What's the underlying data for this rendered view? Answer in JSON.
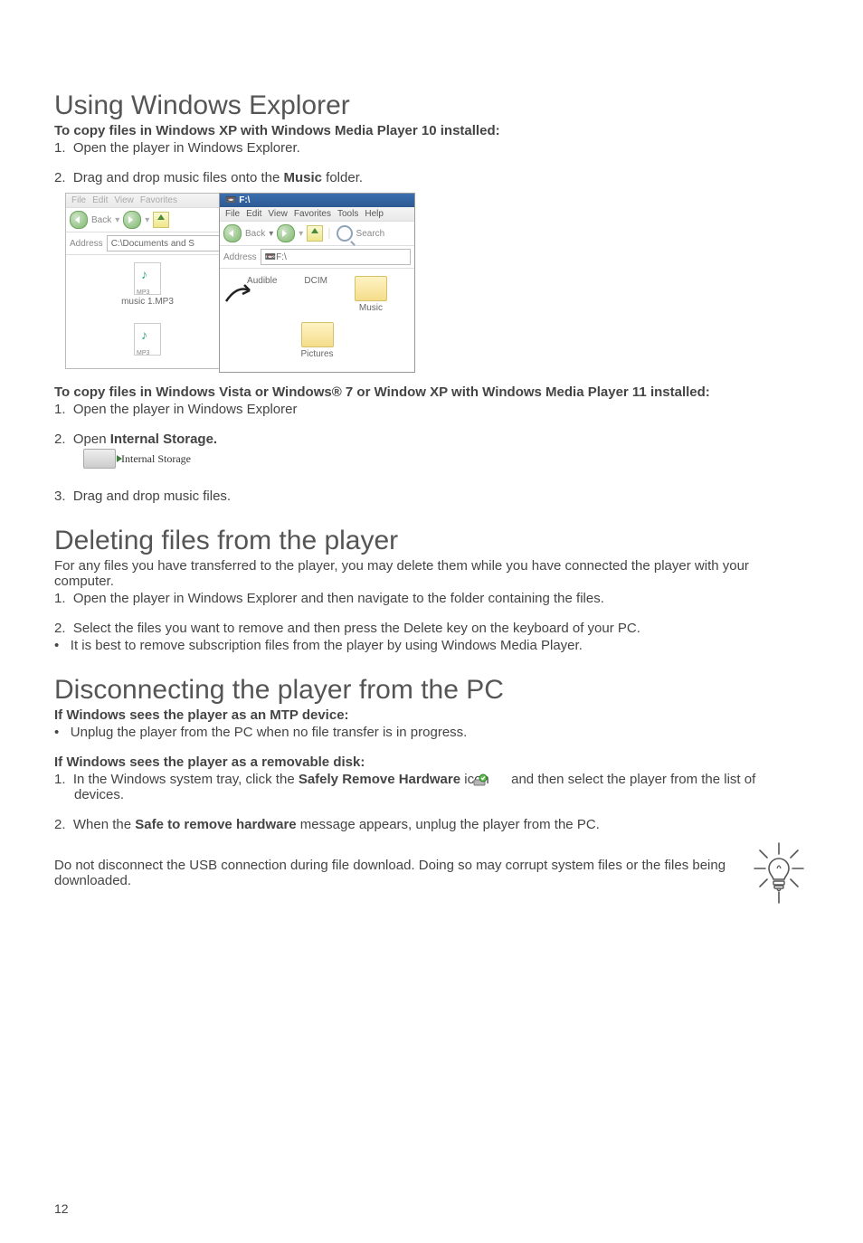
{
  "page_number": "12",
  "sec1": {
    "heading": "Using Windows Explorer",
    "sub1": "To copy files in Windows XP with Windows Media Player 10 installed:",
    "step1_num": "1.",
    "step1_text": "Open the player in Windows Explorer.",
    "step2_num": "2.",
    "step2_pre": "Drag and drop music files onto the ",
    "step2_bold": "Music",
    "step2_post": " folder.",
    "win_back": {
      "menu": [
        "File",
        "Edit",
        "View",
        "Favorites"
      ],
      "toolbar_back": "Back",
      "addr_label": "Address",
      "addr_value": "C:\\Documents and S",
      "file1_tag": "MP3",
      "file1_label": "music 1.MP3",
      "file2_tag": "MP3"
    },
    "win_front": {
      "title": "F:\\",
      "menu": [
        "File",
        "Edit",
        "View",
        "Favorites",
        "Tools",
        "Help"
      ],
      "toolbar_back": "Back",
      "toolbar_search": "Search",
      "addr_label": "Address",
      "addr_value": "F:\\",
      "folders": [
        "Audible",
        "DCIM",
        "Music",
        "Pictures"
      ]
    },
    "sub2": "To copy files in Windows Vista or Windows® 7 or Window XP with Windows Media Player 11 installed:",
    "s2_step1_num": "1.",
    "s2_step1_text": "Open the player in Windows Explorer",
    "s2_step2_num": "2.",
    "s2_step2_pre": "Open ",
    "s2_step2_bold": "Internal Storage.",
    "internal_storage_label": "Internal Storage",
    "s2_step3_num": "3.",
    "s2_step3_text": "Drag and drop music files."
  },
  "sec2": {
    "heading": "Deleting files from the player",
    "intro": "For any files you have transferred to the player, you may delete them while you have connected the player with your computer.",
    "step1_num": "1.",
    "step1_text": "Open the player in Windows Explorer and then navigate to the folder containing the files.",
    "step2_num": "2.",
    "step2_text": "Select the files you want to remove and then press the Delete key on the keyboard of your PC.",
    "bullet_mark": "•",
    "bullet_text": "It is best to remove subscription files from the player by using Windows Media Player."
  },
  "sec3": {
    "heading": "Disconnecting the player from the PC",
    "sub1": "If Windows sees the player as an MTP device:",
    "bullet_mark": "•",
    "b1_text": "Unplug the player from the PC when no file transfer is in progress.",
    "sub2": "If Windows sees the player as a removable disk:",
    "s1_num": "1.",
    "s1_pre": "In the Windows system tray, click the ",
    "s1_bold": "Safely Remove Hardware",
    "s1_mid": " icon ",
    "s1_post": " and then select the player from the list of devices.",
    "s2_num": "2.",
    "s2_pre": "When the ",
    "s2_bold": "Safe to remove hardware",
    "s2_post": " message appears, unplug the player from the PC.",
    "callout": "Do not disconnect the USB connection during file download. Doing so may corrupt system files or the files being downloaded."
  }
}
